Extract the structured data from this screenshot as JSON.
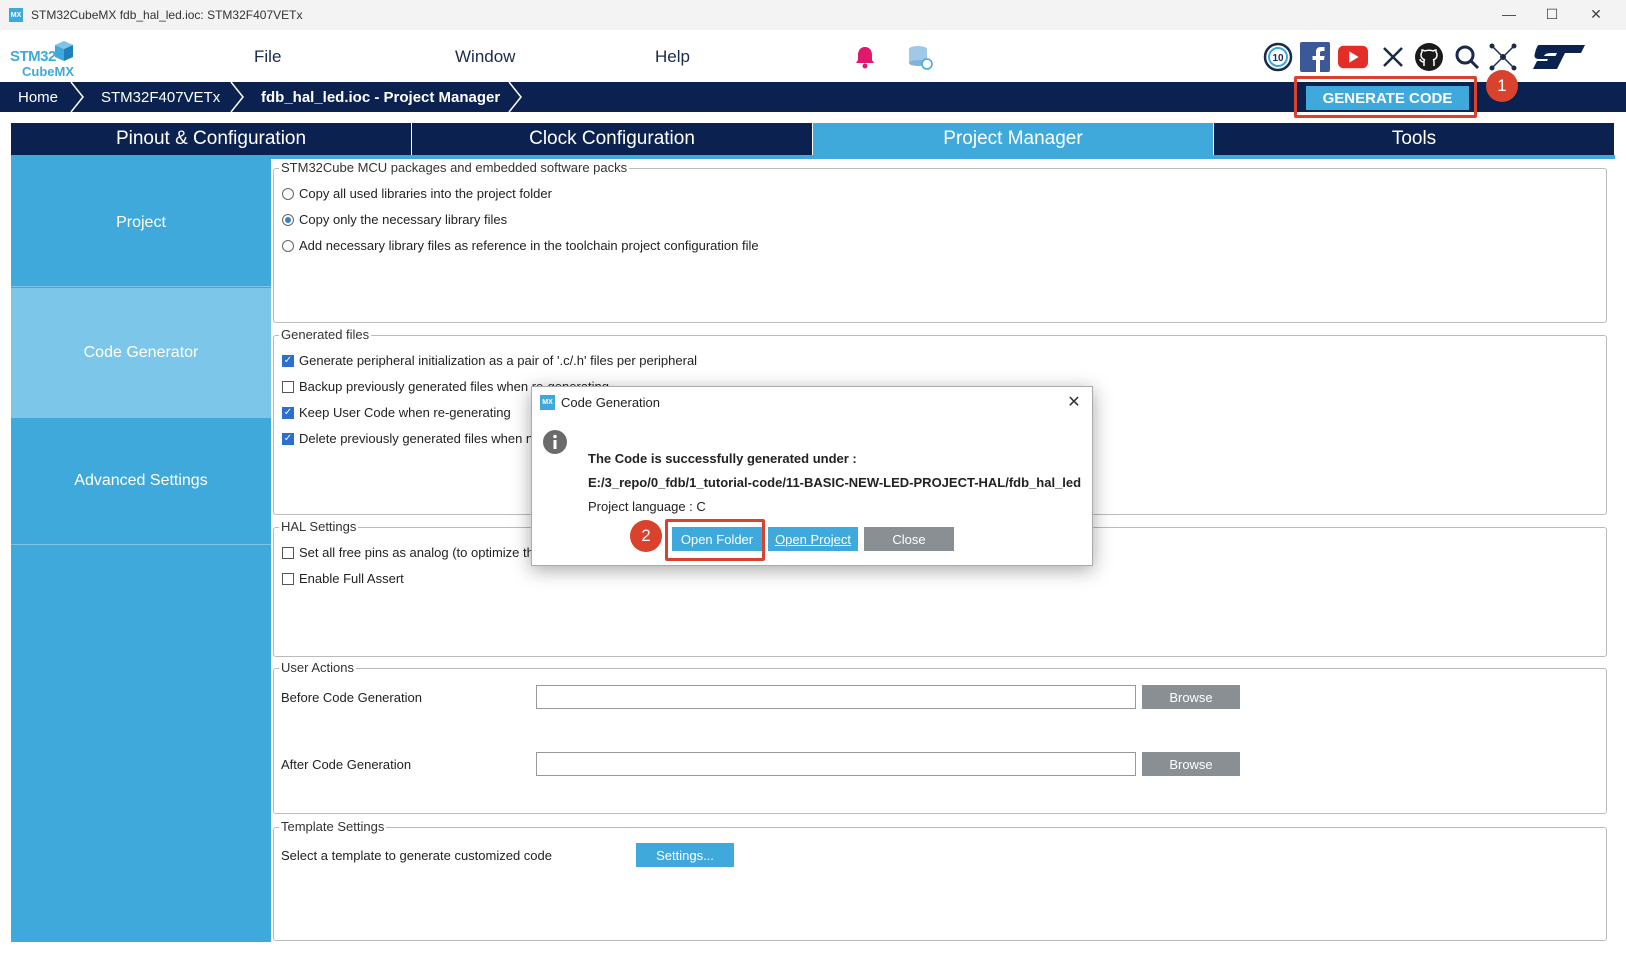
{
  "window": {
    "title": "STM32CubeMX fdb_hal_led.ioc: STM32F407VETx",
    "app_badge": "MX",
    "minimize": "—",
    "maximize": "☐",
    "close": "✕"
  },
  "brand": {
    "line1": "STM32",
    "line2": "CubeMX"
  },
  "menu": {
    "file": "File",
    "window": "Window",
    "help": "Help"
  },
  "social_icons": [
    "anniversary-10-icon",
    "facebook-icon",
    "youtube-icon",
    "x-icon",
    "github-icon",
    "search-icon",
    "network-icon",
    "st-logo-icon"
  ],
  "breadcrumb": {
    "home": "Home",
    "device": "STM32F407VETx",
    "project": "fdb_hal_led.ioc - Project Manager"
  },
  "generate_button": "GENERATE CODE",
  "badges": {
    "first": "1",
    "second": "2"
  },
  "tabs": [
    "Pinout & Configuration",
    "Clock Configuration",
    "Project Manager",
    "Tools"
  ],
  "active_tab": "Project Manager",
  "sidebar": {
    "items": [
      "Project",
      "Code Generator",
      "Advanced Settings"
    ],
    "active": "Code Generator"
  },
  "packages": {
    "legend": "STM32Cube MCU packages and embedded software packs",
    "options": [
      {
        "label": "Copy all used libraries into the project folder",
        "selected": false
      },
      {
        "label": "Copy only the necessary library files",
        "selected": true
      },
      {
        "label": "Add necessary library files as reference in the toolchain project configuration file",
        "selected": false
      }
    ]
  },
  "generated_files": {
    "legend": "Generated files",
    "options": [
      {
        "label": "Generate peripheral initialization as a pair of '.c/.h' files per peripheral",
        "checked": true
      },
      {
        "label": "Backup previously generated files when re-generating",
        "checked": false
      },
      {
        "label": "Keep User Code when re-generating",
        "checked": true
      },
      {
        "label": "Delete previously generated files when no",
        "checked": true
      }
    ]
  },
  "hal_settings": {
    "legend": "HAL Settings",
    "options": [
      {
        "label": "Set all free pins as analog (to optimize th",
        "checked": false
      },
      {
        "label": "Enable Full Assert",
        "checked": false
      }
    ]
  },
  "user_actions": {
    "legend": "User Actions",
    "before_label": "Before Code Generation",
    "before_value": "",
    "after_label": "After Code Generation",
    "after_value": "",
    "browse": "Browse"
  },
  "template_settings": {
    "legend": "Template Settings",
    "label": "Select a template to generate customized code",
    "button": "Settings..."
  },
  "dialog": {
    "title": "Code Generation",
    "badge": "MX",
    "heading": "The Code is successfully generated under :",
    "path": "E:/3_repo/0_fdb/1_tutorial-code/11-BASIC-NEW-LED-PROJECT-HAL/fdb_hal_led",
    "language": "Project language : C",
    "open_folder": "Open Folder",
    "open_project": "Open Project",
    "close": "Close"
  },
  "colors": {
    "accent": "#3fa9dc",
    "navy": "#0b2250",
    "highlight": "#d9432e"
  }
}
